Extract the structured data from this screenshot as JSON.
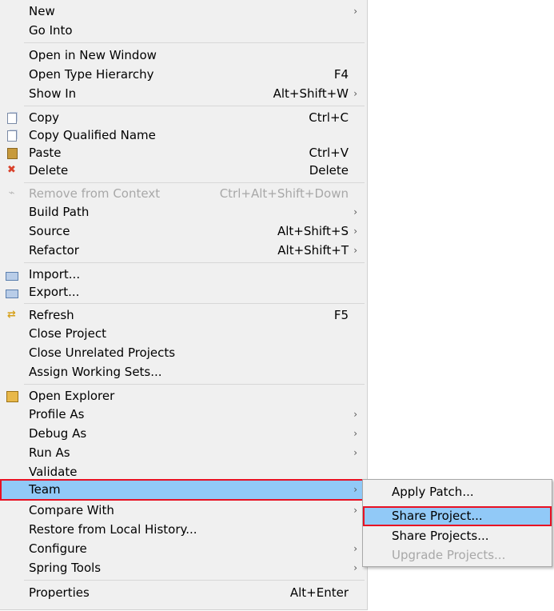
{
  "main_menu": {
    "items": [
      {
        "label": "New",
        "shortcut": "",
        "arrow": "›"
      },
      {
        "label": "Go Into",
        "shortcut": "",
        "arrow": ""
      },
      {
        "label": "Open in New Window",
        "shortcut": "",
        "arrow": ""
      },
      {
        "label": "Open Type Hierarchy",
        "shortcut": "F4",
        "arrow": ""
      },
      {
        "label": "Show In",
        "shortcut": "Alt+Shift+W",
        "arrow": "›"
      },
      {
        "label": "Copy",
        "shortcut": "Ctrl+C",
        "arrow": ""
      },
      {
        "label": "Copy Qualified Name",
        "shortcut": "",
        "arrow": ""
      },
      {
        "label": "Paste",
        "shortcut": "Ctrl+V",
        "arrow": ""
      },
      {
        "label": "Delete",
        "shortcut": "Delete",
        "arrow": ""
      },
      {
        "label": "Remove from Context",
        "shortcut": "Ctrl+Alt+Shift+Down",
        "arrow": ""
      },
      {
        "label": "Build Path",
        "shortcut": "",
        "arrow": "›"
      },
      {
        "label": "Source",
        "shortcut": "Alt+Shift+S",
        "arrow": "›"
      },
      {
        "label": "Refactor",
        "shortcut": "Alt+Shift+T",
        "arrow": "›"
      },
      {
        "label": "Import...",
        "shortcut": "",
        "arrow": ""
      },
      {
        "label": "Export...",
        "shortcut": "",
        "arrow": ""
      },
      {
        "label": "Refresh",
        "shortcut": "F5",
        "arrow": ""
      },
      {
        "label": "Close Project",
        "shortcut": "",
        "arrow": ""
      },
      {
        "label": "Close Unrelated Projects",
        "shortcut": "",
        "arrow": ""
      },
      {
        "label": "Assign Working Sets...",
        "shortcut": "",
        "arrow": ""
      },
      {
        "label": "Open Explorer",
        "shortcut": "",
        "arrow": ""
      },
      {
        "label": "Profile As",
        "shortcut": "",
        "arrow": "›"
      },
      {
        "label": "Debug As",
        "shortcut": "",
        "arrow": "›"
      },
      {
        "label": "Run As",
        "shortcut": "",
        "arrow": "›"
      },
      {
        "label": "Validate",
        "shortcut": "",
        "arrow": ""
      },
      {
        "label": "Team",
        "shortcut": "",
        "arrow": "›"
      },
      {
        "label": "Compare With",
        "shortcut": "",
        "arrow": "›"
      },
      {
        "label": "Restore from Local History...",
        "shortcut": "",
        "arrow": ""
      },
      {
        "label": "Configure",
        "shortcut": "",
        "arrow": "›"
      },
      {
        "label": "Spring Tools",
        "shortcut": "",
        "arrow": "›"
      },
      {
        "label": "Properties",
        "shortcut": "Alt+Enter",
        "arrow": ""
      }
    ]
  },
  "sub_menu": {
    "items": [
      {
        "label": "Apply Patch..."
      },
      {
        "label": "Share Project..."
      },
      {
        "label": "Share Projects..."
      },
      {
        "label": "Upgrade Projects..."
      }
    ]
  },
  "icons": {
    "copy": "copy-icon",
    "copy_qualified": "copy-qualified-name-icon",
    "paste": "paste-icon",
    "delete": "delete-icon",
    "remove_context": "remove-from-context-icon",
    "import": "import-icon",
    "export": "export-icon",
    "refresh": "refresh-icon",
    "open_explorer": "open-explorer-icon",
    "delete_glyph": "✖",
    "refresh_glyph": "⇄"
  },
  "colors": {
    "menu_bg": "#f0f0f0",
    "highlight": "#91c9f7",
    "callout_border": "#e81123",
    "disabled_text": "#a8a8a8",
    "delete_red": "#d9412b"
  }
}
